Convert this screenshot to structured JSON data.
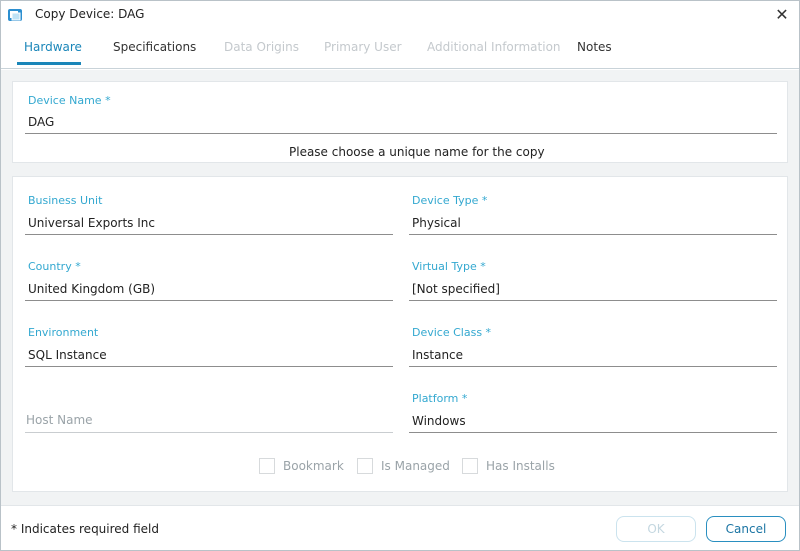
{
  "window": {
    "title": "Copy Device: DAG",
    "close_glyph": "✕"
  },
  "tabs": [
    {
      "label": "Hardware",
      "state": "active"
    },
    {
      "label": "Specifications",
      "state": "enabled"
    },
    {
      "label": "Data Origins",
      "state": "disabled"
    },
    {
      "label": "Primary User",
      "state": "disabled"
    },
    {
      "label": "Additional Information",
      "state": "disabled"
    },
    {
      "label": "Notes",
      "state": "enabled"
    }
  ],
  "device_name": {
    "label": "Device Name *",
    "value": "DAG",
    "hint": "Please choose a unique name for the copy"
  },
  "fields": {
    "business_unit": {
      "label": "Business Unit",
      "value": "Universal Exports Inc"
    },
    "device_type": {
      "label": "Device Type *",
      "value": "Physical"
    },
    "country": {
      "label": "Country *",
      "value": "United Kingdom (GB)"
    },
    "virtual_type": {
      "label": "Virtual Type *",
      "value": "[Not specified]"
    },
    "environment": {
      "label": "Environment",
      "value": "SQL Instance"
    },
    "device_class": {
      "label": "Device Class *",
      "value": "Instance"
    },
    "host_name": {
      "placeholder": "Host Name",
      "value": ""
    },
    "platform": {
      "label": "Platform *",
      "value": "Windows"
    }
  },
  "checkboxes": [
    {
      "label": "Bookmark",
      "checked": false
    },
    {
      "label": "Is Managed",
      "checked": false
    },
    {
      "label": "Has Installs",
      "checked": false
    }
  ],
  "footer": {
    "required_note": "* Indicates required field",
    "ok_label": "OK",
    "cancel_label": "Cancel"
  },
  "colors": {
    "accent": "#1a86b9",
    "label": "#33a8d0",
    "disabled": "#c4c9cd",
    "background": "#f1f3f4"
  }
}
